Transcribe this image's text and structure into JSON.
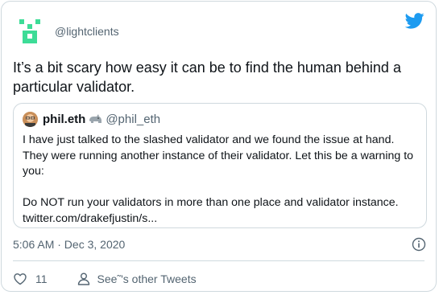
{
  "author": {
    "handle": "@lightclients",
    "avatar_icon": "pixel-logo-icon",
    "accent": "#3ddc97"
  },
  "brand": {
    "icon": "twitter-bird-icon",
    "color": "#1d9bf0"
  },
  "tweet": {
    "text": "It’s a bit scary how easy it can be to find the human behind a particular validator."
  },
  "quoted_tweet": {
    "name": "phil.eth",
    "badge_icon": "rhino-emoji-icon",
    "handle": "@phil_eth",
    "text": "I have just talked to the slashed validator and we found the issue at hand. They were running another instance of their validator. Let this be a warning to you:\n\nDo NOT run your validators in more than one place and validator instance. twitter.com/drakefjustin/s..."
  },
  "meta": {
    "timestamp": "5:06 AM · Dec 3, 2020",
    "info_icon": "info-icon"
  },
  "actions": {
    "like_icon": "heart-icon",
    "like_count": "11",
    "profile_icon": "person-icon",
    "other_tweets_label": "See˜'s other Tweets"
  }
}
